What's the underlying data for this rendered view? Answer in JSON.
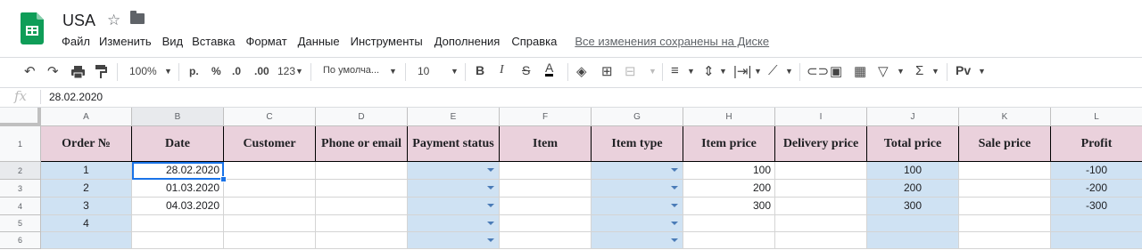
{
  "doc": {
    "title": "USA",
    "saved_status": "Все изменения сохранены на Диске"
  },
  "menu": [
    "Файл",
    "Изменить",
    "Вид",
    "Вставка",
    "Формат",
    "Данные",
    "Инструменты",
    "Дополнения",
    "Справка"
  ],
  "toolbar": {
    "zoom": "100%",
    "currency": "р.",
    "percent": "%",
    "dec_less": ".0",
    "dec_more": ".00",
    "format_more": "123",
    "font": "По умолча...",
    "font_size": "10",
    "bold": "B",
    "italic": "I",
    "strike": "S",
    "text_color": "A",
    "sigma": "Σ",
    "input_tools": "Рv"
  },
  "formula_bar": {
    "fx": "fx",
    "value": "28.02.2020"
  },
  "colors": {
    "header_fill": "#ead1dc",
    "column_fill": "#cfe2f3",
    "selection": "#1a73e8"
  },
  "grid": {
    "columns": [
      "A",
      "B",
      "C",
      "D",
      "E",
      "F",
      "G",
      "H",
      "I",
      "J",
      "K",
      "L"
    ],
    "row_numbers": [
      "1",
      "2",
      "3",
      "4",
      "5",
      "6"
    ],
    "headers": [
      "Order №",
      "Date",
      "Customer",
      "Phone or email",
      "Payment status",
      "Item",
      "Item type",
      "Item price",
      "Delivery price",
      "Total price",
      "Sale price",
      "Profit"
    ],
    "rows": [
      [
        "1",
        "28.02.2020",
        "",
        "",
        "",
        "",
        "",
        "100",
        "",
        "100",
        "",
        "-100"
      ],
      [
        "2",
        "01.03.2020",
        "",
        "",
        "",
        "",
        "",
        "200",
        "",
        "200",
        "",
        "-200"
      ],
      [
        "3",
        "04.03.2020",
        "",
        "",
        "",
        "",
        "",
        "300",
        "",
        "300",
        "",
        "-300"
      ],
      [
        "4",
        "",
        "",
        "",
        "",
        "",
        "",
        "",
        "",
        "",
        "",
        ""
      ],
      [
        "",
        "",
        "",
        "",
        "",
        "",
        "",
        "",
        "",
        "",
        "",
        ""
      ]
    ]
  }
}
